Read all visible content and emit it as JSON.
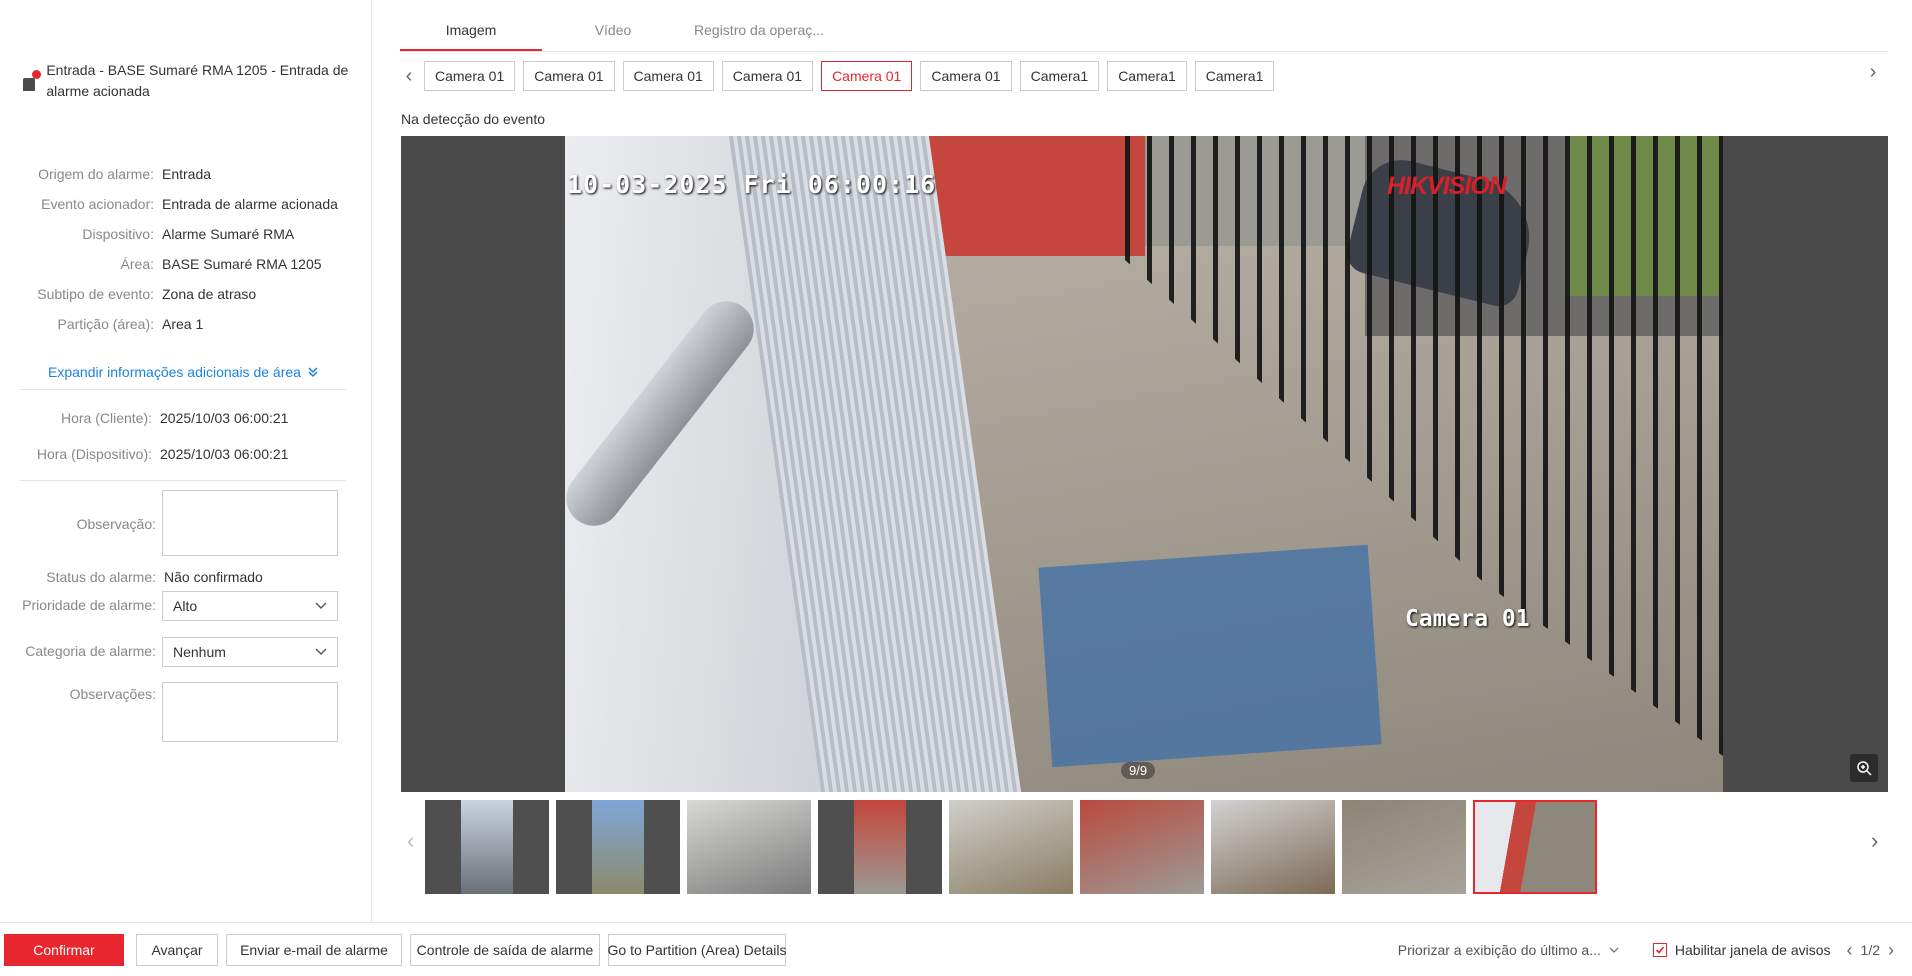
{
  "alarm": {
    "title": "Entrada - BASE Sumaré RMA 1205 - Entrada de alarme acionada"
  },
  "details": [
    {
      "label": "Origem do alarme:",
      "value": "Entrada"
    },
    {
      "label": "Evento acionador:",
      "value": "Entrada de alarme acionada"
    },
    {
      "label": "Dispositivo:",
      "value": "Alarme Sumaré RMA"
    },
    {
      "label": "Área:",
      "value": "BASE Sumaré RMA 1205"
    },
    {
      "label": "Subtipo de evento:",
      "value": "Zona de atraso"
    },
    {
      "label": "Partição (área):",
      "value": "Area 1"
    }
  ],
  "expand_link": "Expandir informações adicionais de área",
  "times": [
    {
      "label": "Hora (Cliente):",
      "value": "2025/10/03 06:00:21"
    },
    {
      "label": "Hora (Dispositivo):",
      "value": "2025/10/03 06:00:21"
    }
  ],
  "form": {
    "observacao_label": "Observação:",
    "observacao_value": "",
    "status_label": "Status do alarme:",
    "status_value": "Não confirmado",
    "priority_label": "Prioridade de alarme:",
    "priority_value": "Alto",
    "category_label": "Categoria de alarme:",
    "category_value": "Nenhum",
    "observacoes_label": "Observações:",
    "observacoes_value": ""
  },
  "tabs": [
    {
      "label": "Imagem",
      "active": true
    },
    {
      "label": "Vídeo",
      "active": false
    },
    {
      "label": "Registro da operaç...",
      "active": false
    }
  ],
  "cameras": [
    {
      "label": "Camera 01",
      "active": false
    },
    {
      "label": "Camera 01",
      "active": false
    },
    {
      "label": "Camera 01",
      "active": false
    },
    {
      "label": "Camera 01",
      "active": false
    },
    {
      "label": "Camera 01",
      "active": true
    },
    {
      "label": "Camera 01",
      "active": false
    },
    {
      "label": "Camera1",
      "active": false
    },
    {
      "label": "Camera1",
      "active": false
    },
    {
      "label": "Camera1",
      "active": false
    }
  ],
  "event_label": "Na detecção do evento",
  "image": {
    "osd_time": "10-03-2025 Fri 06:00:16",
    "osd_brand": "HIKVISION",
    "osd_camera": "Camera 01",
    "page_indicator": "9/9"
  },
  "thumbnails": [
    {
      "active": false
    },
    {
      "active": false
    },
    {
      "active": false
    },
    {
      "active": false
    },
    {
      "active": false
    },
    {
      "active": false
    },
    {
      "active": false
    },
    {
      "active": false
    },
    {
      "active": true
    }
  ],
  "bottom": {
    "confirm": "Confirmar",
    "advance": "Avançar",
    "email": "Enviar e-mail de alarme",
    "output_control": "Controle de saída de alarme",
    "partition_details": "Go to Partition (Area) Details",
    "priority_display": "Priorizar a exibição do último a...",
    "enable_popup": "Habilitar janela de avisos",
    "enable_popup_checked": true,
    "pager": "1/2"
  },
  "colors": {
    "accent": "#e8262d",
    "link": "#1a82e2"
  }
}
